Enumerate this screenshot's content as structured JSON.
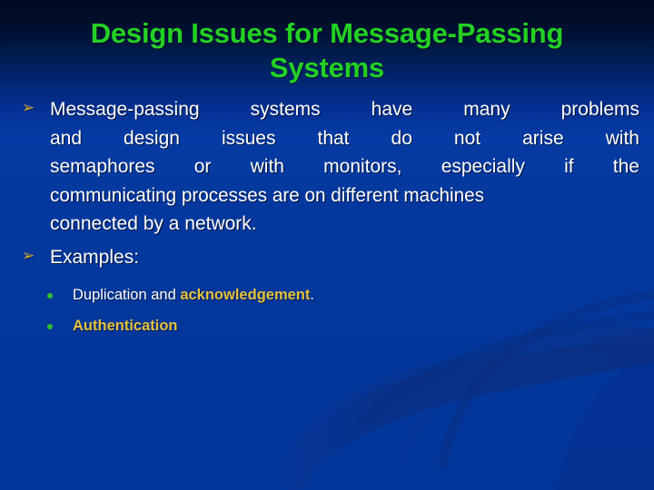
{
  "slide": {
    "title": {
      "lines": [
        "Design Issues for Message-Passing",
        "Systems"
      ],
      "color": "#24D024"
    },
    "background": {
      "top_color": "#000A20",
      "bottom_color": "#03379B",
      "swoosh_color": "#0A2F86"
    },
    "bullets": [
      {
        "marker": "arrow-bullet-icon",
        "marker_glyph": "➢",
        "marker_color": "#D9A92C",
        "lines": [
          "Message-passing systems have many problems",
          "and design issues that do not arise with",
          "semaphores or with monitors, especially if the",
          "communicating processes are on different machines",
          "connected by a network."
        ]
      },
      {
        "marker": "arrow-bullet-icon",
        "marker_glyph": "➢",
        "marker_color": "#D9A92C",
        "lines": [
          "Examples:"
        ]
      }
    ],
    "sub_bullets": [
      {
        "marker": "square-dot-icon",
        "marker_color": "#2FBE2F",
        "prefix": "Duplication and ",
        "emphasis": "acknowledgement",
        "suffix": ".",
        "emphasis_color": "#E5C23F"
      },
      {
        "marker": "square-dot-icon",
        "marker_color": "#2FBE2F",
        "prefix": "",
        "emphasis": "Authentication",
        "suffix": "",
        "emphasis_color": "#E5C23F"
      }
    ]
  }
}
